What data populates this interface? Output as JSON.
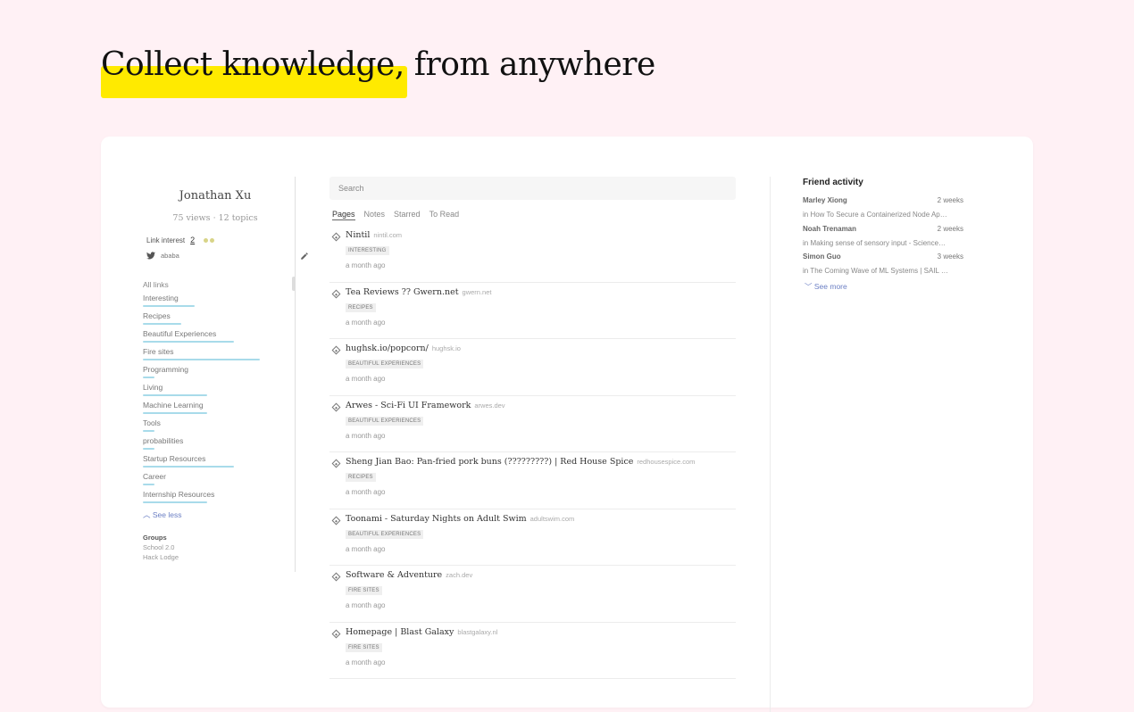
{
  "headline": {
    "highlight": "Collect knowledge,",
    "rest": " from anywhere"
  },
  "profile": {
    "name": "Jonathan Xu",
    "stats": "75 views · 12 topics",
    "link_interest_label": "Link interest",
    "link_interest_count": "2",
    "handle": "ababa"
  },
  "links": {
    "heading": "All links",
    "topics": [
      {
        "label": "Interesting",
        "level": 0.44
      },
      {
        "label": "Recipes",
        "level": 0.33
      },
      {
        "label": "Beautiful Experiences",
        "level": 0.78
      },
      {
        "label": "Fire sites",
        "level": 1.0
      },
      {
        "label": "Programming",
        "level": 0.1
      },
      {
        "label": "Living",
        "level": 0.55
      },
      {
        "label": "Machine Learning",
        "level": 0.55
      },
      {
        "label": "Tools",
        "level": 0.1
      },
      {
        "label": "probabilities",
        "level": 0.1
      },
      {
        "label": "Startup Resources",
        "level": 0.78
      },
      {
        "label": "Career",
        "level": 0.1
      },
      {
        "label": "Internship Resources",
        "level": 0.55
      }
    ],
    "see_less": "See less"
  },
  "groups": {
    "heading": "Groups",
    "items": [
      "School 2.0",
      "Hack Lodge"
    ]
  },
  "search": {
    "placeholder": "Search"
  },
  "tabs": [
    "Pages",
    "Notes",
    "Starred",
    "To Read"
  ],
  "pages": [
    {
      "title": "Nintil",
      "domain": "nintil.com",
      "tag": "INTERESTING",
      "time": "a month ago"
    },
    {
      "title": "Tea Reviews ?? Gwern.net",
      "domain": "gwern.net",
      "tag": "RECIPES",
      "time": "a month ago"
    },
    {
      "title": "hughsk.io/popcorn/",
      "domain": "hughsk.io",
      "tag": "BEAUTIFUL EXPERIENCES",
      "time": "a month ago"
    },
    {
      "title": "Arwes - Sci-Fi UI Framework",
      "domain": "arwes.dev",
      "tag": "BEAUTIFUL EXPERIENCES",
      "time": "a month ago"
    },
    {
      "title": "Sheng Jian Bao: Pan-fried pork buns (?????????) | Red House Spice",
      "domain": "redhousespice.com",
      "tag": "RECIPES",
      "time": "a month ago"
    },
    {
      "title": "Toonami - Saturday Nights on Adult Swim",
      "domain": "adultswim.com",
      "tag": "BEAUTIFUL EXPERIENCES",
      "time": "a month ago"
    },
    {
      "title": "Software & Adventure",
      "domain": "zach.dev",
      "tag": "FIRE SITES",
      "time": "a month ago"
    },
    {
      "title": "Homepage | Blast Galaxy",
      "domain": "blastgalaxy.nl",
      "tag": "FIRE SITES",
      "time": "a month ago"
    }
  ],
  "friends": {
    "heading": "Friend activity",
    "items": [
      {
        "name": "Marley Xiong",
        "time": "2 weeks",
        "doc": "in How To Secure a Containerized Node Ap…"
      },
      {
        "name": "Noah Trenaman",
        "time": "2 weeks",
        "doc": "in Making sense of sensory input - Science…"
      },
      {
        "name": "Simon Guo",
        "time": "3 weeks",
        "doc": "in The Coming Wave of ML Systems | SAIL …"
      }
    ],
    "see_more": "See more"
  },
  "colors": {
    "background": "#fff1f5",
    "highlight": "#ffea00",
    "topic_bar": "#a8dbea",
    "accent_link": "#6b7fc4"
  }
}
